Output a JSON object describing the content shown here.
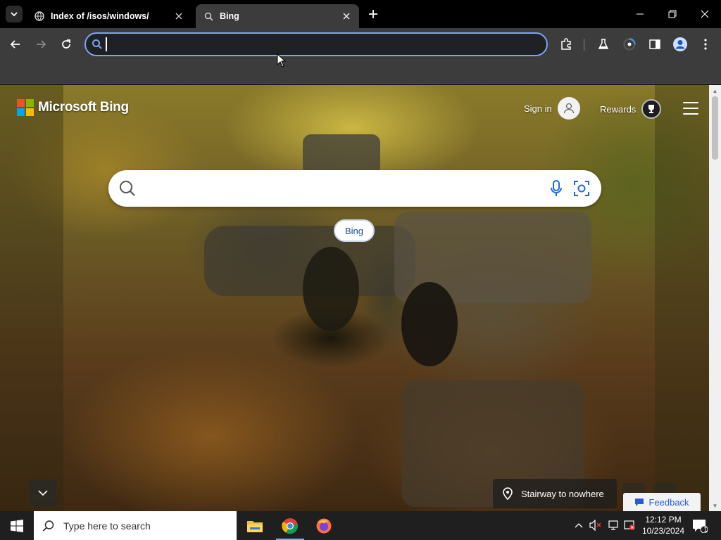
{
  "browser": {
    "tabs": [
      {
        "title": "Index of /isos/windows/",
        "active": false
      },
      {
        "title": "Bing",
        "active": true
      }
    ],
    "omnibox": {
      "value": "",
      "placeholder": ""
    }
  },
  "bing": {
    "logo_text": "Microsoft Bing",
    "sign_in_label": "Sign in",
    "rewards_label": "Rewards",
    "search_placeholder": "",
    "chip_label": "Bing",
    "image_title": "Stairway to nowhere",
    "feedback_label": "Feedback"
  },
  "taskbar": {
    "search_placeholder": "Type here to search",
    "time": "12:12 PM",
    "date": "10/23/2024",
    "notification_count": "1"
  },
  "colors": {
    "chrome_dark": "#000000",
    "chrome_toolbar": "#3c3c3c",
    "omnibox_focus": "#7ca4f5",
    "ms_red": "#f25022",
    "ms_green": "#7fba00",
    "ms_blue": "#00a4ef",
    "ms_yellow": "#ffb900",
    "feedback_blue": "#2a5bd7"
  }
}
